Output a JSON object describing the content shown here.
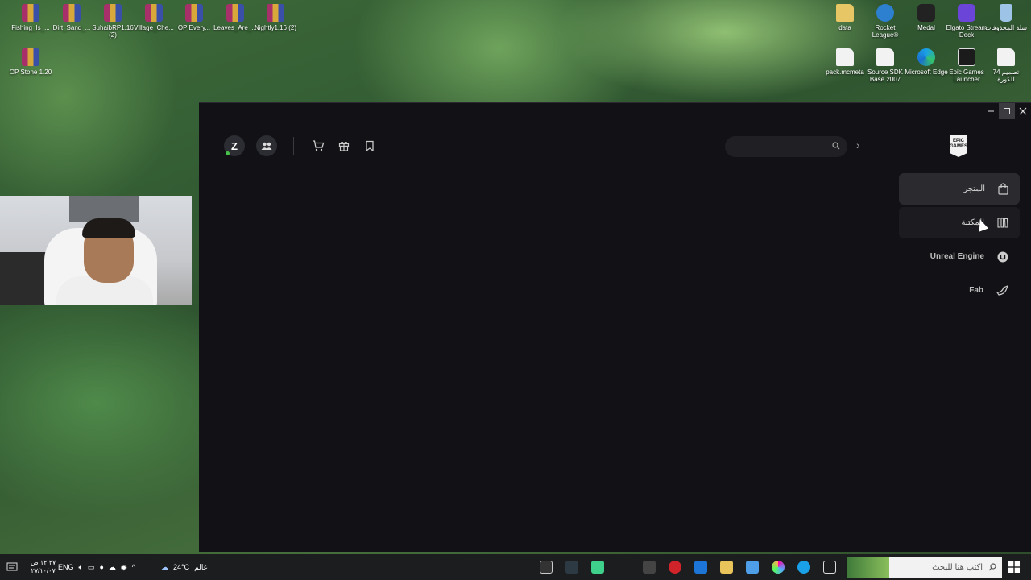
{
  "desktop": {
    "icons_left": [
      {
        "label": "Fishing_Is_...",
        "type": "rar"
      },
      {
        "label": "Dirt_Sand_...",
        "type": "rar"
      },
      {
        "label": "SuhaibRP1.16 (2)",
        "type": "rar"
      },
      {
        "label": "Village_Che...",
        "type": "rar"
      },
      {
        "label": "OP Every...",
        "type": "rar"
      },
      {
        "label": "Leaves_Are_...",
        "type": "rar"
      },
      {
        "label": "Nightly1.16 (2)",
        "type": "rar"
      },
      {
        "label": "OP Stone 1.20",
        "type": "rar"
      }
    ],
    "icons_right": [
      {
        "label": "data",
        "type": "folder"
      },
      {
        "label": "Rocket League®",
        "type": "rocket"
      },
      {
        "label": "Medal",
        "type": "medal"
      },
      {
        "label": "Elgato Stream Deck",
        "type": "elgato"
      },
      {
        "label": "سلة المحذوفات",
        "type": "bin"
      },
      {
        "label": "pack.mcmeta",
        "type": "file"
      },
      {
        "label": "Source SDK Base 2007",
        "type": "file"
      },
      {
        "label": "Microsoft Edge",
        "type": "edge"
      },
      {
        "label": "Epic Games Launcher",
        "type": "epic"
      },
      {
        "label": "تصميم 74 للكورة",
        "type": "file"
      }
    ]
  },
  "launcher": {
    "avatar_letter": "Z",
    "logo_text": "EPIC GAMES",
    "search_placeholder": "",
    "nav": [
      {
        "label": "المتجر",
        "icon": "shopping-bag-icon",
        "state": "active"
      },
      {
        "label": "المكتبة",
        "icon": "library-icon",
        "state": "hover"
      },
      {
        "label": "Unreal Engine",
        "icon": "unreal-icon",
        "state": "normal"
      },
      {
        "label": "Fab",
        "icon": "fab-icon",
        "state": "normal"
      }
    ]
  },
  "taskbar": {
    "time": "١٢:٣٧ ص",
    "date": "٢٧/١٠/٠٧",
    "language": "ENG",
    "weather_temp": "24°C",
    "weather_label": "عالم",
    "search_placeholder": "اكتب هنا للبحث"
  }
}
